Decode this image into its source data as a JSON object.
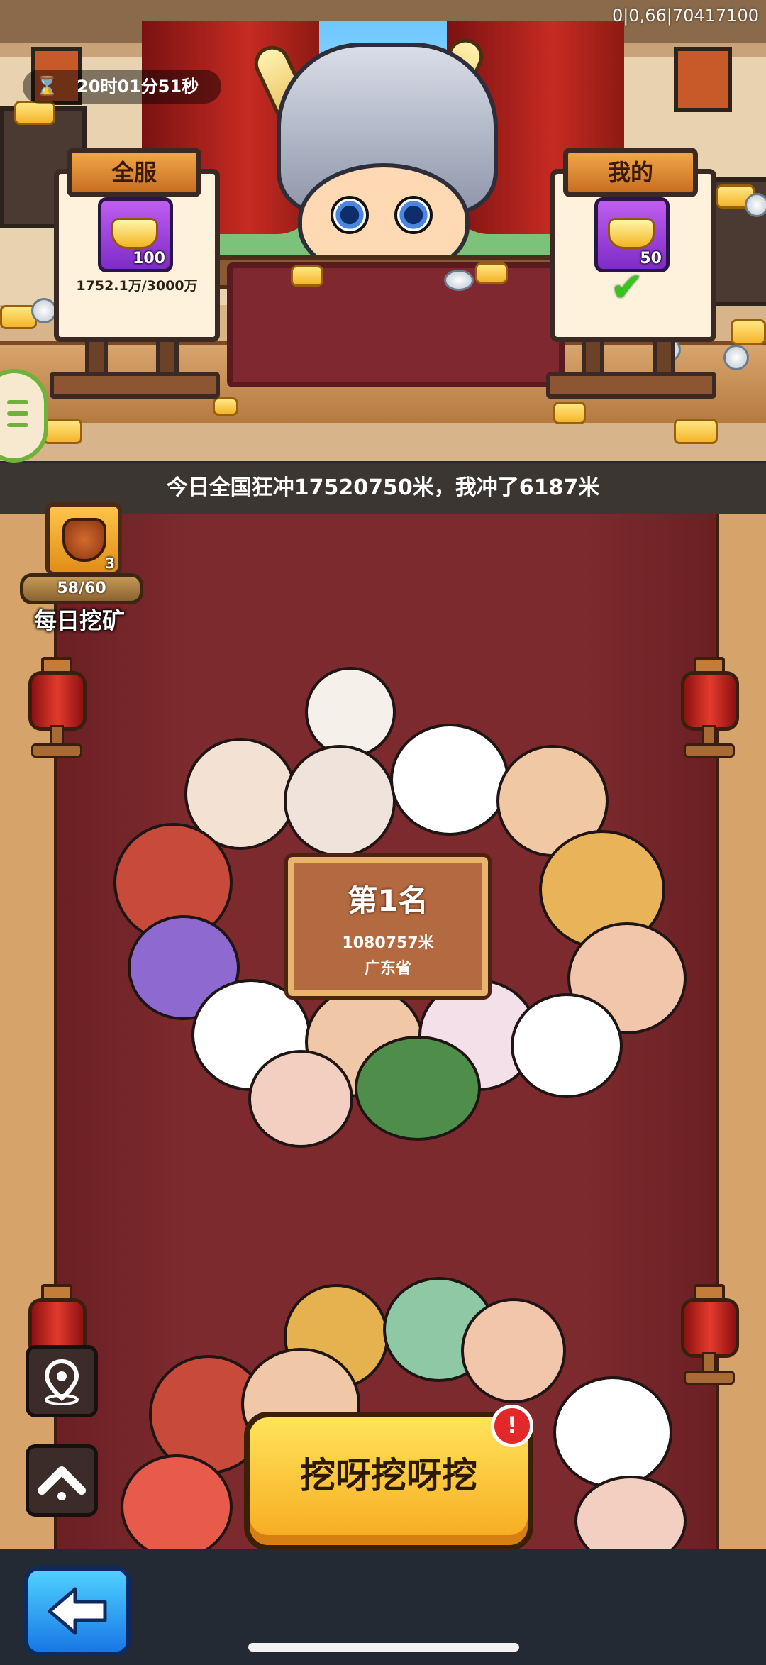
{
  "debug_text": "0|0,66|70417100",
  "timer": {
    "icon": "hourglass-icon",
    "text": "20时01分51秒"
  },
  "server_sign": {
    "title": "全服",
    "icon": "gold-ingot-icon",
    "count": "100",
    "progress": "1752.1万/3000万"
  },
  "my_sign": {
    "title": "我的",
    "icon": "gold-ingot-icon",
    "count": "50",
    "claimed_icon": "checkmark-icon"
  },
  "banner": {
    "text": "今日全国狂冲17520750米，我冲了6187米"
  },
  "daily_mining": {
    "icon": "mining-chest-icon",
    "count": "3",
    "progress": "58/60",
    "label": "每日挖矿"
  },
  "rank_card": {
    "title": "第1名",
    "distance": "1080757米",
    "province": "广东省"
  },
  "side_buttons": {
    "location_icon": "location-pin-icon",
    "up_icon": "chevron-up-icon"
  },
  "dig_button": {
    "label": "挖呀挖呀挖",
    "badge": "!"
  },
  "bottom_bar": {
    "back_icon": "back-arrow-icon"
  },
  "colors": {
    "road": "#7c2a2d",
    "button_gold": "#f7c431",
    "badge_red": "#e22828",
    "check_green": "#37c51d",
    "sign_roof": "#e38b34"
  }
}
